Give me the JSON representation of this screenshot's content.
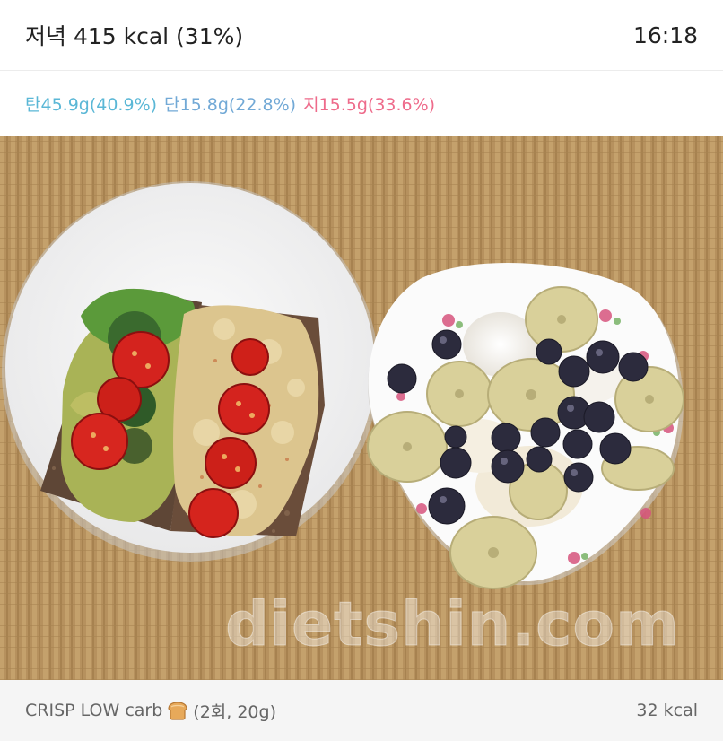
{
  "header": {
    "title": "저녁 415 kcal (31%)",
    "time": "16:18"
  },
  "macros": {
    "carb": "탄45.9g(40.9%)",
    "protein": "단15.8g(22.8%)",
    "fat": "지15.5g(33.6%)"
  },
  "photo": {
    "watermark": "dietshin.com",
    "icon": "meal-photo"
  },
  "footer": {
    "food_name": "CRISP LOW carb",
    "food_icon": "bread-icon",
    "food_detail": "(2회, 20g)",
    "kcal": "32 kcal"
  },
  "colors": {
    "carb": "#5ab7d6",
    "protein": "#72a9d6",
    "fat": "#ee6b8b",
    "mat": "#b99460"
  }
}
